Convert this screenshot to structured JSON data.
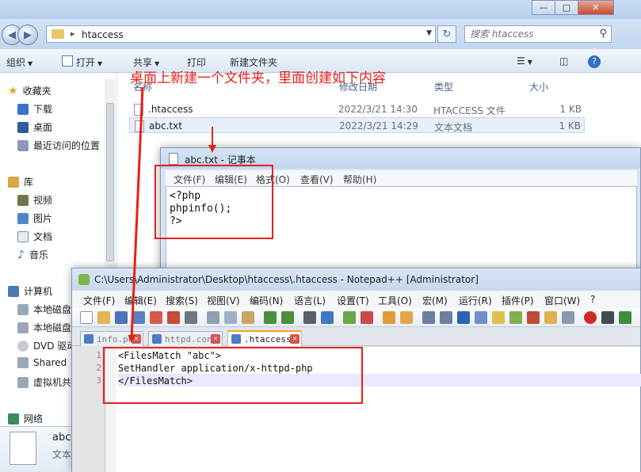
{
  "explorer": {
    "address": "htaccess",
    "search_placeholder": "搜索 htaccess",
    "commands": {
      "organize": "组织",
      "open": "打开",
      "share": "共享",
      "print": "打印",
      "new_folder": "新建文件夹"
    },
    "sidebar": {
      "favorites": "收藏夹",
      "downloads": "下载",
      "desktop": "桌面",
      "recent": "最近访问的位置",
      "libraries": "库",
      "videos": "视频",
      "pictures": "图片",
      "documents": "文档",
      "music": "音乐",
      "computer": "计算机",
      "local_disk_1": "本地磁盘",
      "local_disk_2": "本地磁盘",
      "dvd": "DVD 驱动",
      "shared": "Shared",
      "vm_share": "虚拟机共",
      "network": "网络"
    },
    "columns": {
      "name": "名称",
      "modified": "修改日期",
      "type": "类型",
      "size": "大小"
    },
    "files": [
      {
        "name": ".htaccess",
        "modified": "2022/3/21 14:30",
        "type": "HTACCESS 文件",
        "size": "1 KB"
      },
      {
        "name": "abc.txt",
        "modified": "2022/3/21 14:29",
        "type": "文本文档",
        "size": "1 KB"
      }
    ],
    "details": {
      "name": "abc",
      "type": "文本"
    }
  },
  "annotation": {
    "text": "桌面上新建一个文件夹，里面创建如下内容",
    "color": "#e8201a"
  },
  "notepad": {
    "title": "abc.txt - 记事本",
    "menu": {
      "file": "文件(F)",
      "edit": "编辑(E)",
      "format": "格式(O)",
      "view": "查看(V)",
      "help": "帮助(H)"
    },
    "lines": [
      "<?php",
      "phpinfo();",
      "?>"
    ]
  },
  "npp": {
    "title": "C:\\Users\\Administrator\\Desktop\\htaccess\\.htaccess - Notepad++ [Administrator]",
    "menu": {
      "file": "文件(F)",
      "edit": "编辑(E)",
      "search": "搜索(S)",
      "view": "视图(V)",
      "encoding": "编码(N)",
      "language": "语言(L)",
      "settings": "设置(T)",
      "tools": "工具(O)",
      "macro": "宏(M)",
      "run": "运行(R)",
      "plugins": "插件(P)",
      "window": "窗口(W)",
      "help": "?"
    },
    "tabs": [
      {
        "label": "info.php"
      },
      {
        "label": "httpd.conf"
      },
      {
        "label": ".htaccess"
      }
    ],
    "line_numbers": [
      "1",
      "2",
      "3"
    ],
    "lines": [
      "<FilesMatch \"abc\">",
      "SetHandler application/x-httpd-php",
      "</FilesMatch>"
    ]
  }
}
